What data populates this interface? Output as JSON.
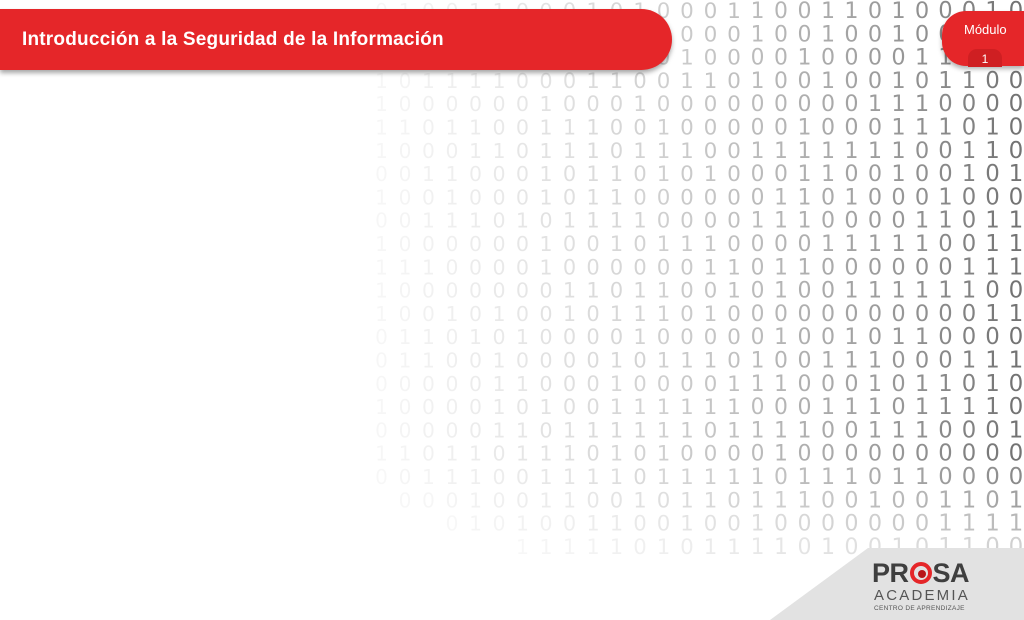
{
  "header": {
    "title": "Introducción a la Seguridad de la Información",
    "module_label": "Módulo",
    "module_number": "1"
  },
  "logo": {
    "brand_left": "PR",
    "brand_right": "SA",
    "academy": "ACADEMIA",
    "subtitle": "CENTRO DE APRENDIZAJE"
  },
  "colors": {
    "brand_red": "#e52629",
    "logo_gray": "#3f3f3f",
    "corner_gray": "#dcdcdc"
  }
}
